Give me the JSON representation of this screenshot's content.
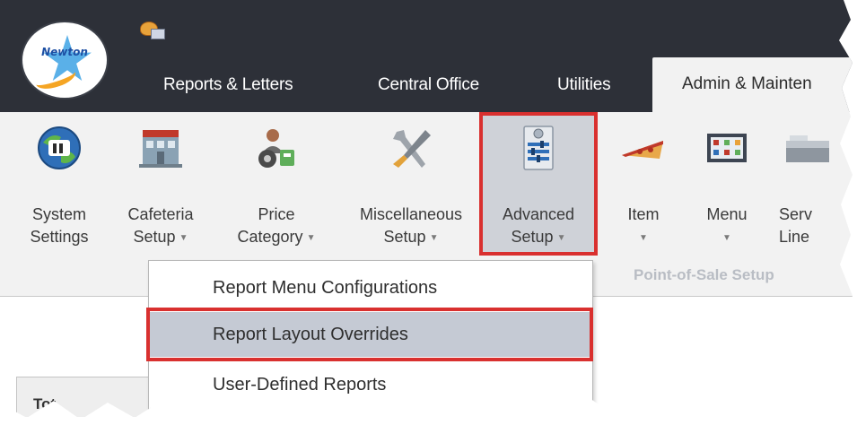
{
  "app": {
    "logo_text": "Newton"
  },
  "tabs": [
    {
      "label": "Reports & Letters"
    },
    {
      "label": "Central Office"
    },
    {
      "label": "Utilities"
    },
    {
      "label": "Admin & Mainten"
    }
  ],
  "ribbon": {
    "buttons": [
      {
        "label": "System\nSettings",
        "icon": "globe-icon"
      },
      {
        "label": "Cafeteria\nSetup",
        "icon": "cafeteria-icon"
      },
      {
        "label": "Price\nCategory",
        "icon": "price-category-icon"
      },
      {
        "label": "Miscellaneous\nSetup",
        "icon": "tools-icon"
      },
      {
        "label": "Advanced\nSetup",
        "icon": "sliders-icon"
      },
      {
        "label": "Item",
        "icon": "pizza-icon"
      },
      {
        "label": "Menu",
        "icon": "menu-board-icon"
      },
      {
        "label": "Serv\nLine",
        "icon": "serving-line-icon"
      }
    ],
    "group_label": "Point-of-Sale Setup"
  },
  "dropdown": {
    "items": [
      {
        "label": "Report Menu Configurations"
      },
      {
        "label": "Report Layout Overrides"
      },
      {
        "label": "User-Defined Reports"
      }
    ]
  },
  "panel": {
    "header": "Tot"
  },
  "colors": {
    "titlebar": "#2d3038",
    "ribbon": "#f2f2f2",
    "highlight_border": "#d9302f",
    "selected_item": "#c5cad4"
  }
}
